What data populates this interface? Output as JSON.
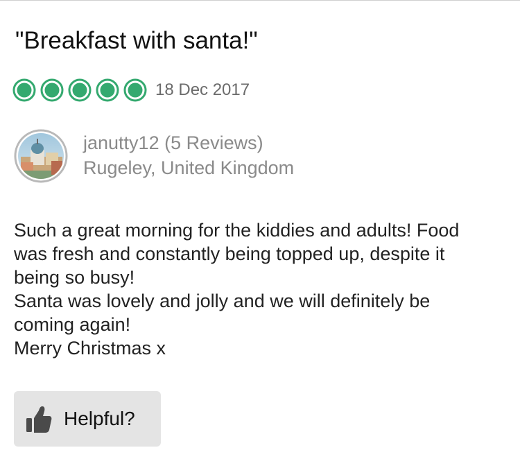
{
  "review": {
    "title": "\"Breakfast with santa!\"",
    "rating": {
      "value": 5,
      "max": 5,
      "color": "#34a96f"
    },
    "date": "18 Dec 2017",
    "reviewer": {
      "name_line": "janutty12 (5 Reviews)",
      "location": "Rugeley, United Kingdom"
    },
    "body_lines": [
      "Such a great morning for the kiddies and adults! Food",
      "was fresh and constantly being topped up, despite it",
      "being so busy!",
      "Santa was lovely and jolly and we will definitely be",
      "coming again!",
      "Merry Christmas x"
    ]
  },
  "helpful_button": {
    "label": "Helpful?",
    "icon": "thumbs-up-icon"
  }
}
